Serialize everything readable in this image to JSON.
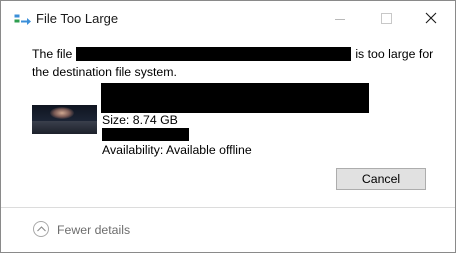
{
  "window": {
    "title": "File Too Large",
    "icon": "file-move-icon"
  },
  "titlebar_buttons": {
    "minimize_icon": "minimize-icon",
    "maximize_icon": "maximize-icon",
    "close_icon": "close-icon"
  },
  "message": {
    "before": "The file",
    "after": "is too large for the destination file system."
  },
  "file": {
    "size": "Size: 8.74 GB",
    "availability": "Availability: Available offline"
  },
  "buttons": {
    "cancel": "Cancel"
  },
  "footer": {
    "toggle_label": "Fewer details",
    "toggle_icon": "chevron-up-icon"
  },
  "colors": {
    "window_bg": "#ffffff",
    "button_bg": "#e1e1e1",
    "button_border": "#adadad",
    "footer_text": "#6d6d6d",
    "redaction": "#000000"
  }
}
